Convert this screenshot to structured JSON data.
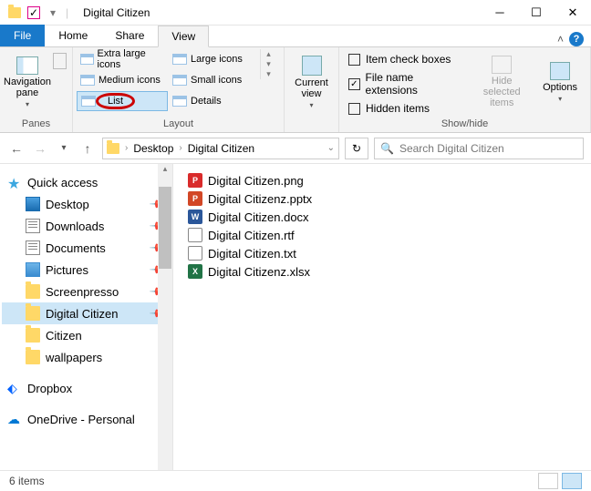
{
  "window": {
    "title": "Digital Citizen"
  },
  "tabs": {
    "file": "File",
    "home": "Home",
    "share": "Share",
    "view": "View",
    "active": "View"
  },
  "ribbon": {
    "panes": {
      "label": "Panes",
      "nav": "Navigation pane"
    },
    "layout": {
      "label": "Layout",
      "items": [
        "Extra large icons",
        "Large icons",
        "Medium icons",
        "Small icons",
        "List",
        "Details"
      ],
      "selected": "List"
    },
    "current_view": {
      "label": "Current view"
    },
    "showhide": {
      "label": "Show/hide",
      "item_check": "Item check boxes",
      "file_ext": "File name extensions",
      "hidden": "Hidden items",
      "hide_sel": "Hide selected items",
      "options": "Options"
    }
  },
  "breadcrumbs": [
    "Desktop",
    "Digital Citizen"
  ],
  "search": {
    "placeholder": "Search Digital Citizen"
  },
  "tree": {
    "quick_access": "Quick access",
    "items": [
      {
        "label": "Desktop",
        "icon": "desktop",
        "pinned": true
      },
      {
        "label": "Downloads",
        "icon": "doc",
        "pinned": true
      },
      {
        "label": "Documents",
        "icon": "doc",
        "pinned": true
      },
      {
        "label": "Pictures",
        "icon": "pic",
        "pinned": true
      },
      {
        "label": "Screenpresso",
        "icon": "folder",
        "pinned": true
      },
      {
        "label": "Digital Citizen",
        "icon": "folder",
        "pinned": true,
        "selected": true
      },
      {
        "label": "Citizen",
        "icon": "folder",
        "pinned": false
      },
      {
        "label": "wallpapers",
        "icon": "folder",
        "pinned": false
      }
    ],
    "dropbox": "Dropbox",
    "onedrive": "OneDrive - Personal"
  },
  "files": [
    {
      "name": "Digital Citizen.png",
      "color": "#d92b2b",
      "glyph": "P"
    },
    {
      "name": "Digital Citizenz.pptx",
      "color": "#d24726",
      "glyph": "P"
    },
    {
      "name": "Digital Citizen.docx",
      "color": "#2b579a",
      "glyph": "W"
    },
    {
      "name": "Digital Citizen.rtf",
      "color": "#888888",
      "glyph": ""
    },
    {
      "name": "Digital Citizen.txt",
      "color": "#888888",
      "glyph": ""
    },
    {
      "name": "Digital Citizenz.xlsx",
      "color": "#217346",
      "glyph": "X"
    }
  ],
  "status": {
    "count": "6 items"
  }
}
